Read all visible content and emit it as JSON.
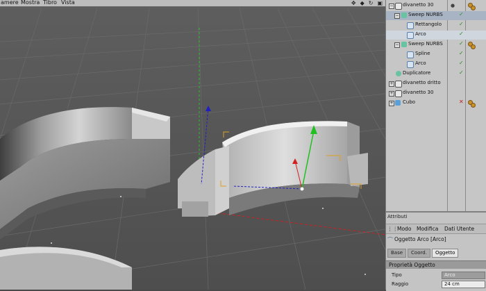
{
  "viewport": {
    "menu": [
      "amere",
      "Mostra",
      "Tibro",
      "Vista"
    ],
    "nav_icons": [
      "move-view-icon",
      "scale-view-icon",
      "rotate-view-icon",
      "maximize-view-icon"
    ],
    "nav_glyphs": [
      "✥",
      "◆",
      "↻",
      "▣"
    ]
  },
  "object_manager": {
    "items": [
      {
        "label": "divanetto 30",
        "indent": 0,
        "icon": "null-icon"
      },
      {
        "label": "Sweep NURBS",
        "indent": 1,
        "icon": "sweep-nurbs-icon"
      },
      {
        "label": "Rettangolo",
        "indent": 2,
        "icon": "spline-icon"
      },
      {
        "label": "Arco",
        "indent": 2,
        "icon": "spline-icon"
      },
      {
        "label": "Sweep NURBS",
        "indent": 1,
        "icon": "sweep-nurbs-icon"
      },
      {
        "label": "Spline",
        "indent": 2,
        "icon": "spline-icon"
      },
      {
        "label": "Arco",
        "indent": 2,
        "icon": "spline-icon"
      },
      {
        "label": "Duplicatore",
        "indent": 1,
        "icon": "duplicator-icon"
      },
      {
        "label": "divanetto dritto",
        "indent": 0,
        "icon": "null-icon"
      },
      {
        "label": "divanetto 30",
        "indent": 0,
        "icon": "null-icon"
      },
      {
        "label": "Cubo",
        "indent": 0,
        "icon": "cube-icon"
      }
    ]
  },
  "attributes": {
    "title": "Attributi",
    "menu": [
      "Modo",
      "Modifica",
      "Dati Utente"
    ],
    "object_label": "Oggetto Arco [Arco]",
    "tabs": [
      "Base",
      "Coord.",
      "Oggetto"
    ],
    "active_tab": "Oggetto",
    "section": "Proprietà Oggetto",
    "fields": [
      {
        "label": "Tipo",
        "value": "Arco"
      },
      {
        "label": "Raggio",
        "value": "24 cm"
      }
    ]
  },
  "colors": {
    "background": "#555555",
    "panel": "#c6c6c6",
    "axis_x": "#d02020",
    "axis_y": "#20c020",
    "axis_z": "#2020c0",
    "selection": "#e0a020"
  }
}
